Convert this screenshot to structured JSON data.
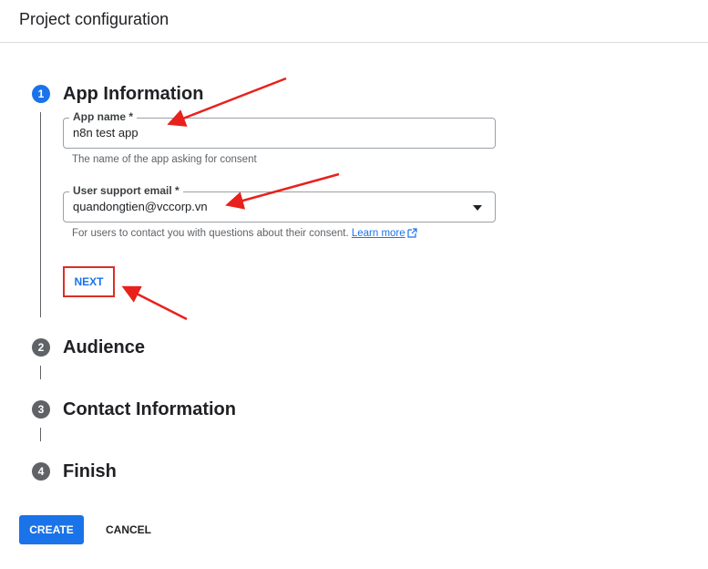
{
  "header": {
    "title": "Project configuration"
  },
  "steps": [
    {
      "number": "1",
      "title": "App Information"
    },
    {
      "number": "2",
      "title": "Audience"
    },
    {
      "number": "3",
      "title": "Contact Information"
    },
    {
      "number": "4",
      "title": "Finish"
    }
  ],
  "app_info": {
    "app_name": {
      "label": "App name *",
      "value": "n8n test app",
      "helper": "The name of the app asking for consent"
    },
    "support_email": {
      "label": "User support email *",
      "value": "quandongtien@vccorp.vn",
      "helper": "For users to contact you with questions about their consent.",
      "link": "Learn more"
    },
    "next_label": "NEXT"
  },
  "footer": {
    "create_label": "CREATE",
    "cancel_label": "CANCEL"
  },
  "colors": {
    "primary": "#1a73e8",
    "annotation_red": "#e8211c",
    "step_inactive": "#5f6368"
  },
  "icons": [
    "external-link-icon",
    "chevron-down-icon"
  ]
}
